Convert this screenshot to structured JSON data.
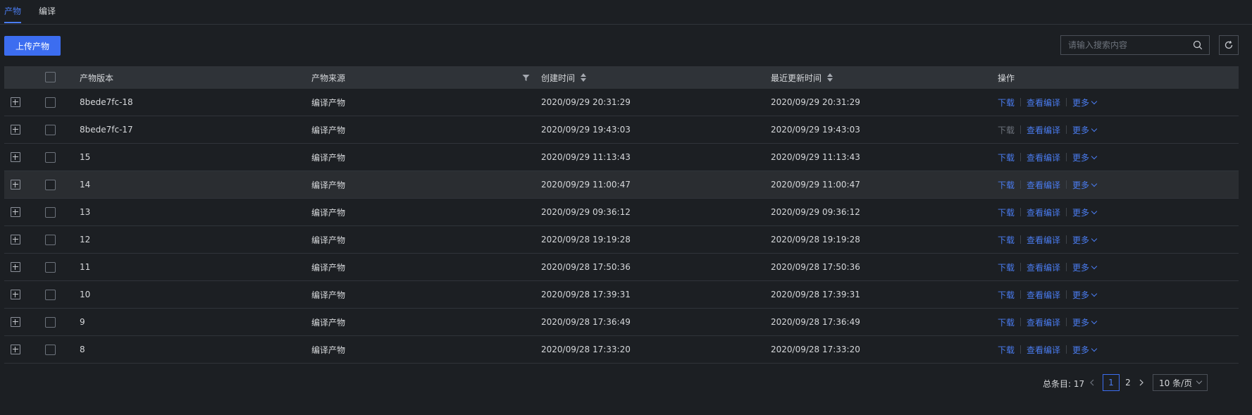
{
  "tabs": [
    {
      "label": "产物",
      "active": true
    },
    {
      "label": "编译",
      "active": false
    }
  ],
  "toolbar": {
    "upload_label": "上传产物",
    "search_placeholder": "请输入搜索内容"
  },
  "table": {
    "columns": {
      "version": "产物版本",
      "source": "产物来源",
      "created": "创建时间",
      "updated": "最近更新时间",
      "ops": "操作"
    },
    "rows": [
      {
        "version": "8bede7fc-18",
        "source": "编译产物",
        "created": "2020/09/29 20:31:29",
        "updated": "2020/09/29 20:31:29",
        "download": "下载",
        "view": "查看编译",
        "more": "更多",
        "download_enabled": true
      },
      {
        "version": "8bede7fc-17",
        "source": "编译产物",
        "created": "2020/09/29 19:43:03",
        "updated": "2020/09/29 19:43:03",
        "download": "下载",
        "view": "查看编译",
        "more": "更多",
        "download_enabled": false
      },
      {
        "version": "15",
        "source": "编译产物",
        "created": "2020/09/29 11:13:43",
        "updated": "2020/09/29 11:13:43",
        "download": "下载",
        "view": "查看编译",
        "more": "更多",
        "download_enabled": true
      },
      {
        "version": "14",
        "source": "编译产物",
        "created": "2020/09/29 11:00:47",
        "updated": "2020/09/29 11:00:47",
        "download": "下载",
        "view": "查看编译",
        "more": "更多",
        "download_enabled": true
      },
      {
        "version": "13",
        "source": "编译产物",
        "created": "2020/09/29 09:36:12",
        "updated": "2020/09/29 09:36:12",
        "download": "下载",
        "view": "查看编译",
        "more": "更多",
        "download_enabled": true
      },
      {
        "version": "12",
        "source": "编译产物",
        "created": "2020/09/28 19:19:28",
        "updated": "2020/09/28 19:19:28",
        "download": "下载",
        "view": "查看编译",
        "more": "更多",
        "download_enabled": true
      },
      {
        "version": "11",
        "source": "编译产物",
        "created": "2020/09/28 17:50:36",
        "updated": "2020/09/28 17:50:36",
        "download": "下载",
        "view": "查看编译",
        "more": "更多",
        "download_enabled": true
      },
      {
        "version": "10",
        "source": "编译产物",
        "created": "2020/09/28 17:39:31",
        "updated": "2020/09/28 17:39:31",
        "download": "下载",
        "view": "查看编译",
        "more": "更多",
        "download_enabled": true
      },
      {
        "version": "9",
        "source": "编译产物",
        "created": "2020/09/28 17:36:49",
        "updated": "2020/09/28 17:36:49",
        "download": "下载",
        "view": "查看编译",
        "more": "更多",
        "download_enabled": true
      },
      {
        "version": "8",
        "source": "编译产物",
        "created": "2020/09/28 17:33:20",
        "updated": "2020/09/28 17:33:20",
        "download": "下载",
        "view": "查看编译",
        "more": "更多",
        "download_enabled": true
      }
    ]
  },
  "pagination": {
    "total_label": "总条目: 17",
    "pages": [
      "1",
      "2"
    ],
    "current_page": "1",
    "page_size_label": "10 条/页"
  },
  "colors": {
    "accent": "#4a7cf0",
    "background": "#1c1f23",
    "header_bg": "#2f3338"
  }
}
